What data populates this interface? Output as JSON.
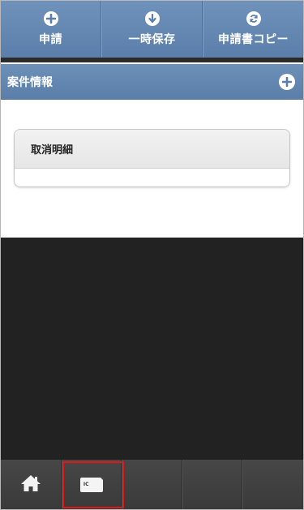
{
  "toolbar": {
    "buttons": [
      {
        "label": "申請",
        "icon": "plus-circle-icon"
      },
      {
        "label": "一時保存",
        "icon": "arrow-down-circle-icon"
      },
      {
        "label": "申請書コピー",
        "icon": "refresh-circle-icon"
      }
    ]
  },
  "section": {
    "title": "案件情報"
  },
  "card": {
    "title": "取消明細"
  },
  "bottom_nav": {
    "items": [
      {
        "icon": "home-icon"
      },
      {
        "icon": "ic-card-icon",
        "label": "IC",
        "highlighted": true
      },
      {
        "icon": ""
      },
      {
        "icon": ""
      },
      {
        "icon": ""
      }
    ]
  },
  "colors": {
    "header_blue": "#5b7faa",
    "dark_area": "#222222",
    "highlight_red": "#e01818"
  }
}
